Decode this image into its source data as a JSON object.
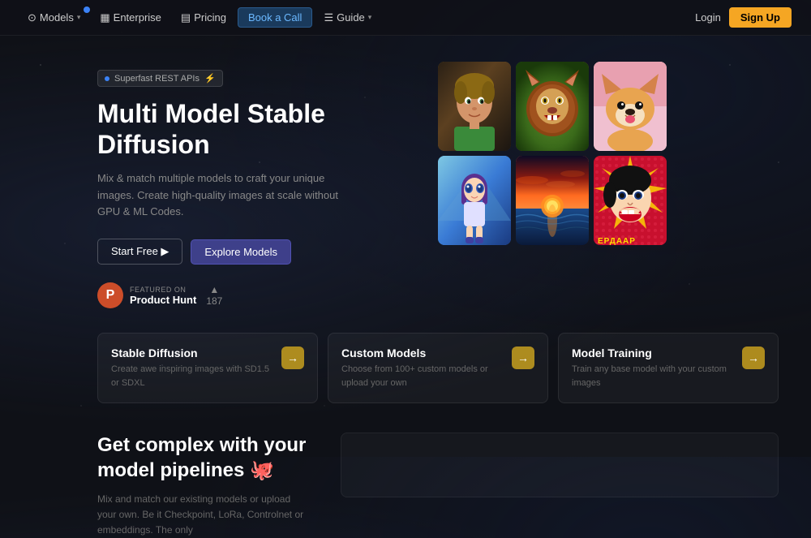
{
  "nav": {
    "items": [
      {
        "id": "models",
        "label": "Models",
        "has_dropdown": true,
        "has_badge": true
      },
      {
        "id": "enterprise",
        "label": "Enterprise",
        "has_dropdown": false
      },
      {
        "id": "pricing",
        "label": "Pricing",
        "has_dropdown": false
      },
      {
        "id": "book_call",
        "label": "Book a Call",
        "is_highlighted": true
      },
      {
        "id": "guide",
        "label": "Guide",
        "has_dropdown": true
      }
    ],
    "login_label": "Login",
    "signup_label": "Sign Up"
  },
  "hero": {
    "badge_text": "Superfast REST APIs",
    "title": "Multi Model Stable Diffusion",
    "subtitle": "Mix & match multiple models to craft your unique images. Create high-quality images at scale without GPU & ML Codes.",
    "btn_start_free": "Start Free ▶",
    "btn_explore": "Explore Models",
    "product_hunt": {
      "featured_label": "FEATURED ON",
      "name": "Product Hunt",
      "votes": "187",
      "arrow": "▲"
    }
  },
  "features": [
    {
      "id": "stable-diffusion",
      "title": "Stable Diffusion",
      "desc": "Create awe inspiring images with SD1.5 or SDXL",
      "arrow": "→"
    },
    {
      "id": "custom-models",
      "title": "Custom Models",
      "desc": "Choose from 100+ custom models or upload your own",
      "arrow": "→"
    },
    {
      "id": "model-training",
      "title": "Model Training",
      "desc": "Train any base model with your custom images",
      "arrow": "→"
    }
  ],
  "bottom": {
    "title": "Get complex with your model pipelines 🐙",
    "desc": "Mix and match our existing models or upload your own. Be it Checkpoint, LoRa, Controlnet or embeddings. The only"
  },
  "images": [
    {
      "id": "img1",
      "alt": "boy portrait"
    },
    {
      "id": "img2",
      "alt": "lion"
    },
    {
      "id": "img3",
      "alt": "corgi"
    },
    {
      "id": "img4",
      "alt": "anime girl"
    },
    {
      "id": "img5",
      "alt": "sunset ocean"
    },
    {
      "id": "img6",
      "alt": "pop art woman"
    }
  ]
}
